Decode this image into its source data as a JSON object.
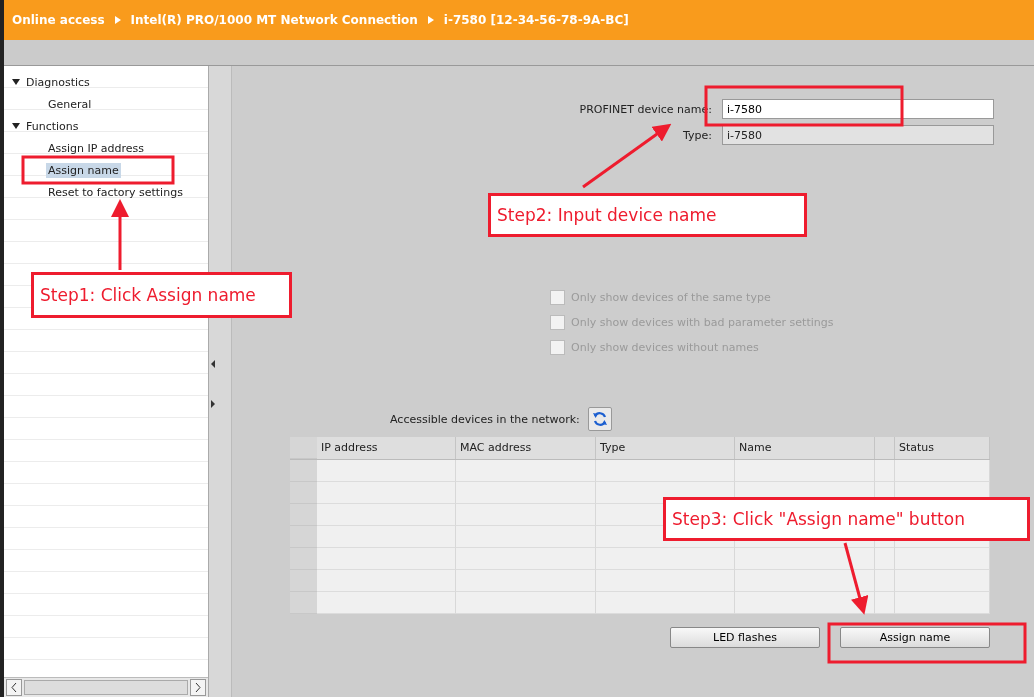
{
  "breadcrumb": [
    "Online access",
    "Intel(R) PRO/1000 MT Network Connection",
    "i-7580 [12-34-56-78-9A-BC]"
  ],
  "tree": [
    {
      "label": "Diagnostics",
      "expanded": true,
      "children": [
        {
          "label": "General",
          "selected": false
        }
      ]
    },
    {
      "label": "Functions",
      "expanded": true,
      "children": [
        {
          "label": "Assign IP address",
          "selected": false
        },
        {
          "label": "Assign name",
          "selected": true
        },
        {
          "label": "Reset to factory settings",
          "selected": false
        }
      ]
    }
  ],
  "device_name": {
    "label": "PROFINET device name:",
    "value": "i-7580"
  },
  "device_type": {
    "label": "Type:",
    "value": "i-7580",
    "disabled": true
  },
  "filters": [
    {
      "label": "Only show devices of the same type",
      "checked": false,
      "disabled": true
    },
    {
      "label": "Only show devices with bad parameter settings",
      "checked": false,
      "disabled": true
    },
    {
      "label": "Only show devices without names",
      "checked": false,
      "disabled": true
    }
  ],
  "accessible_devices": {
    "label": "Accessible devices in the network:"
  },
  "table": {
    "columns": [
      "IP address",
      "MAC address",
      "Type",
      "Name",
      "",
      "Status"
    ]
  },
  "buttons": [
    "LED flashes",
    "Assign name"
  ],
  "annotations": [
    {
      "text": "Step1: Click Assign name"
    },
    {
      "text": "Step2: Input device name"
    },
    {
      "text": "Step3: Click \"Assign name\" button"
    }
  ]
}
